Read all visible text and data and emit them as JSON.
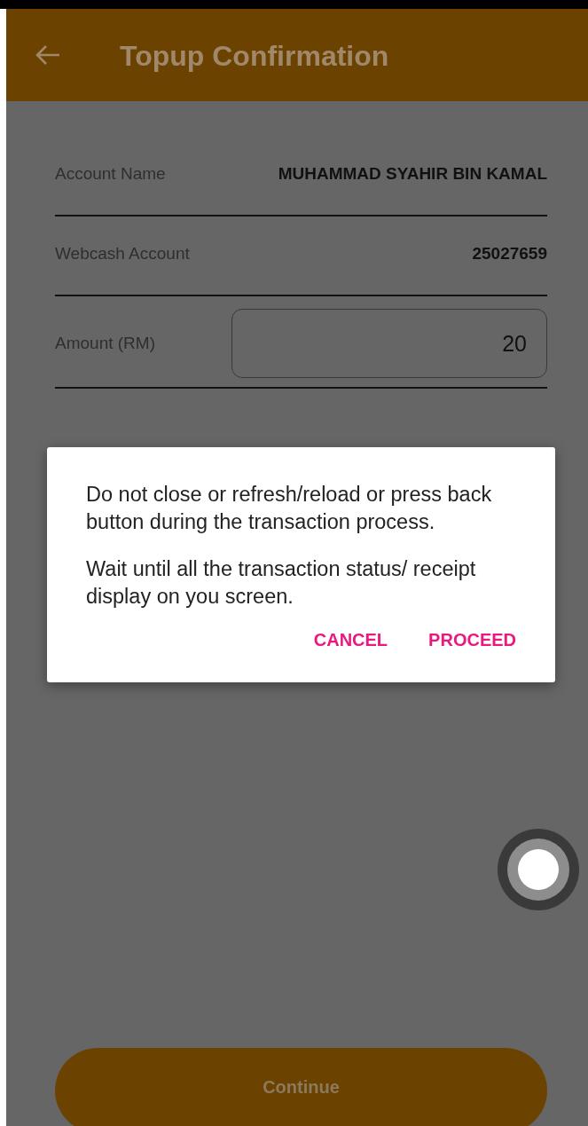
{
  "app_bar": {
    "title": "Topup Confirmation"
  },
  "fields": [
    {
      "kind": "text",
      "label": "Account Name",
      "value": "MUHAMMAD SYAHIR BIN KAMAL"
    },
    {
      "kind": "text",
      "label": "Webcash Account",
      "value": "25027659"
    },
    {
      "kind": "input",
      "label": "Amount (RM)",
      "value": "20"
    }
  ],
  "dialog": {
    "paragraphs": [
      "Do not close or refresh/reload or press back button during the transaction process.",
      "Wait until all the transaction status/ receipt display on you screen."
    ],
    "buttons": [
      "CANCEL",
      "PROCEED"
    ]
  },
  "continue_button": {
    "label": "Continue"
  }
}
